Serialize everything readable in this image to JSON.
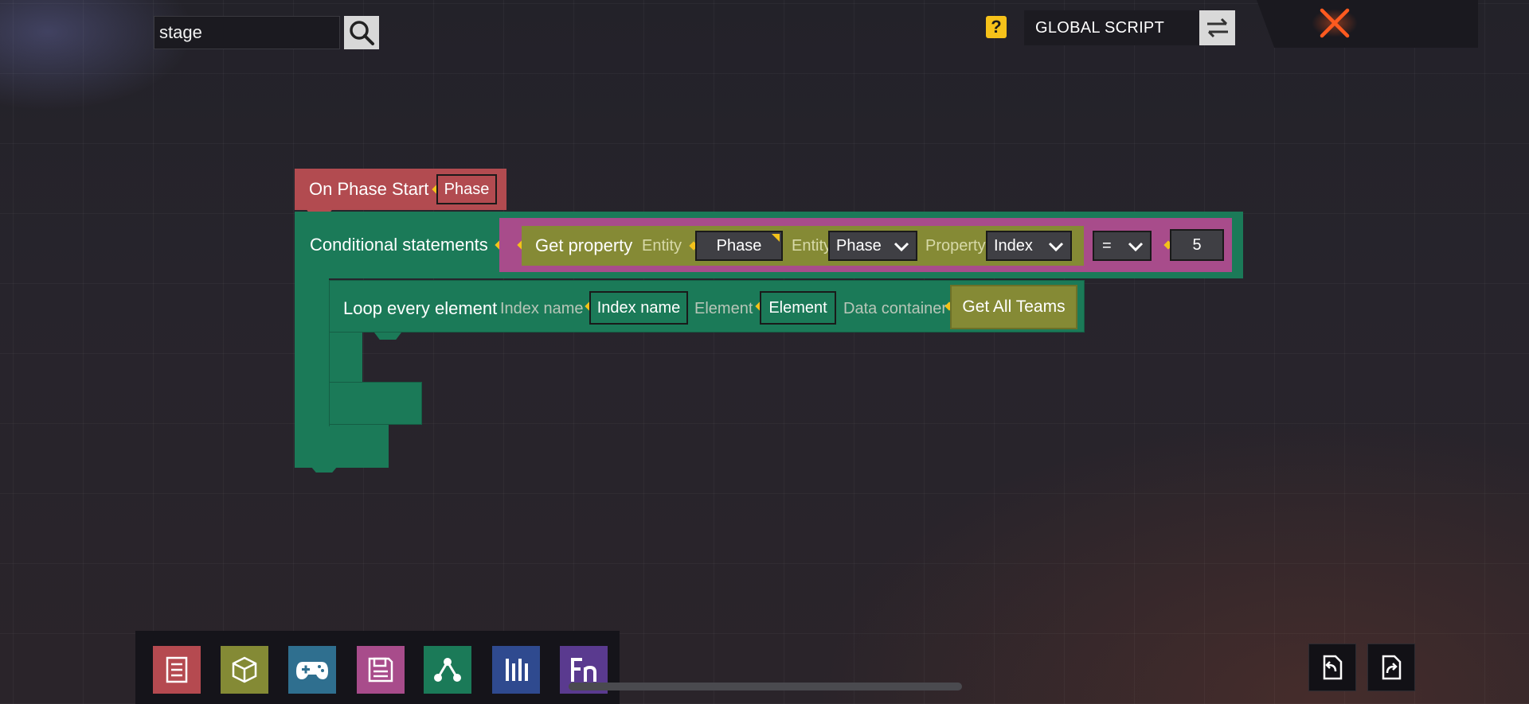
{
  "search": {
    "value": "stage"
  },
  "header": {
    "help_label": "?",
    "script_mode": "GLOBAL SCRIPT"
  },
  "event_block": {
    "title": "On Phase Start",
    "param": "Phase"
  },
  "conditional_block": {
    "title": "Conditional statements",
    "get_property": {
      "title": "Get property",
      "entity_label_1": "Entity",
      "entity_value": "Phase",
      "entity_label_2": "Entity",
      "entity_type": "Phase",
      "property_label": "Property",
      "property_value": "Index"
    },
    "operator": "=",
    "compare_value": "5"
  },
  "loop_block": {
    "title": "Loop every element",
    "index_label": "Index name",
    "index_value": "Index name",
    "element_label": "Element",
    "element_value": "Element",
    "container_label": "Data container",
    "container_value": "Get All Teams"
  },
  "toolbar": {
    "tools": [
      {
        "icon": "list-icon",
        "color": "#b54a50"
      },
      {
        "icon": "cube-icon",
        "color": "#848a35"
      },
      {
        "icon": "gamepad-icon",
        "color": "#2f6f8f"
      },
      {
        "icon": "save-icon",
        "color": "#a84c8b"
      },
      {
        "icon": "share-nodes-icon",
        "color": "#1b7a58"
      },
      {
        "icon": "bars-icon",
        "color": "#2f4a8f"
      },
      {
        "icon": "function-icon",
        "color": "#5a3a8f"
      }
    ]
  },
  "colors": {
    "event": "#b24b50",
    "logic": "#1b7a58",
    "operator": "#a84c8b",
    "value": "#858a35",
    "accent": "#f4c21a",
    "close": "#ff5a1f"
  }
}
